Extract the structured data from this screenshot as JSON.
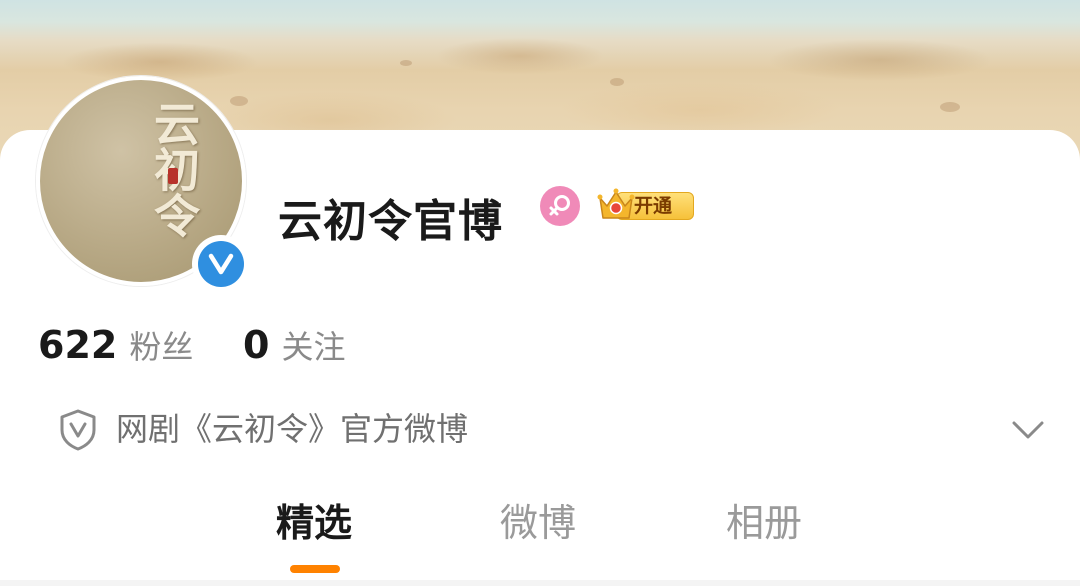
{
  "profile": {
    "name": "云初令官博",
    "avatar_text": "云初令",
    "vip_label": "开通"
  },
  "stats": {
    "followers_count": "622",
    "followers_label": "粉丝",
    "following_count": "0",
    "following_label": "关注"
  },
  "verification": {
    "text": "网剧《云初令》官方微博"
  },
  "tabs": [
    {
      "label": "精选",
      "active": true
    },
    {
      "label": "微博",
      "active": false
    },
    {
      "label": "相册",
      "active": false
    }
  ],
  "colors": {
    "accent": "#ff8200",
    "verified_blue": "#2f8fe0",
    "gender_pink": "#f08ab8",
    "vip_gold": "#f6c13a"
  },
  "icons": {
    "verified": "verified-v-icon",
    "gender": "female-icon",
    "vip": "crown-icon",
    "shield": "shield-v-icon",
    "expand": "chevron-down-icon"
  }
}
